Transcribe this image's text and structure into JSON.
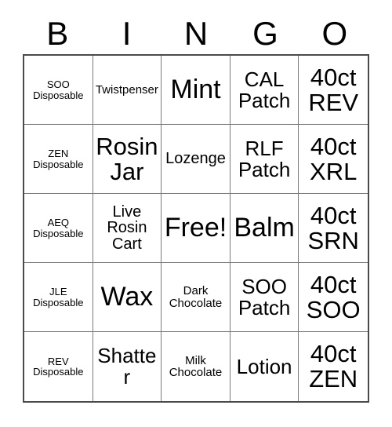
{
  "card": {
    "title": "BINGO",
    "header_letters": [
      "B",
      "I",
      "N",
      "G",
      "O"
    ],
    "columns": 5,
    "rows": 5,
    "free_space": {
      "row": 3,
      "column": 3,
      "label": "Free!"
    },
    "colors": {
      "background": "#ffffff",
      "text": "#000000",
      "grid_line": "#7a7a7a",
      "outer_border": "#4a4a4a"
    },
    "cells": [
      {
        "id": "c-r1-b",
        "row": 1,
        "column": 1,
        "column_letter": "B",
        "text": "SOO\nDisposable",
        "size": "xs"
      },
      {
        "id": "c-r1-i",
        "row": 1,
        "column": 2,
        "column_letter": "I",
        "text": "Twistpenser",
        "size": "sm"
      },
      {
        "id": "c-r1-n",
        "row": 1,
        "column": 3,
        "column_letter": "N",
        "text": "Mint",
        "size": "xxl"
      },
      {
        "id": "c-r1-g",
        "row": 1,
        "column": 4,
        "column_letter": "G",
        "text": "CAL\nPatch",
        "size": "lg"
      },
      {
        "id": "c-r1-o",
        "row": 1,
        "column": 5,
        "column_letter": "O",
        "text": "40ct\nREV",
        "size": "xl"
      },
      {
        "id": "c-r2-b",
        "row": 2,
        "column": 1,
        "column_letter": "B",
        "text": "ZEN\nDisposable",
        "size": "xs"
      },
      {
        "id": "c-r2-i",
        "row": 2,
        "column": 2,
        "column_letter": "I",
        "text": "Rosin\nJar",
        "size": "xl"
      },
      {
        "id": "c-r2-n",
        "row": 2,
        "column": 3,
        "column_letter": "N",
        "text": "Lozenge",
        "size": "md"
      },
      {
        "id": "c-r2-g",
        "row": 2,
        "column": 4,
        "column_letter": "G",
        "text": "RLF\nPatch",
        "size": "lg"
      },
      {
        "id": "c-r2-o",
        "row": 2,
        "column": 5,
        "column_letter": "O",
        "text": "40ct\nXRL",
        "size": "xl"
      },
      {
        "id": "c-r3-b",
        "row": 3,
        "column": 1,
        "column_letter": "B",
        "text": "AEQ\nDisposable",
        "size": "xs"
      },
      {
        "id": "c-r3-i",
        "row": 3,
        "column": 2,
        "column_letter": "I",
        "text": "Live\nRosin\nCart",
        "size": "md"
      },
      {
        "id": "c-r3-n",
        "row": 3,
        "column": 3,
        "column_letter": "N",
        "text": "Free!",
        "size": "xxl"
      },
      {
        "id": "c-r3-g",
        "row": 3,
        "column": 4,
        "column_letter": "G",
        "text": "Balm",
        "size": "xxl"
      },
      {
        "id": "c-r3-o",
        "row": 3,
        "column": 5,
        "column_letter": "O",
        "text": "40ct\nSRN",
        "size": "xl"
      },
      {
        "id": "c-r4-b",
        "row": 4,
        "column": 1,
        "column_letter": "B",
        "text": "JLE\nDisposable",
        "size": "xs"
      },
      {
        "id": "c-r4-i",
        "row": 4,
        "column": 2,
        "column_letter": "I",
        "text": "Wax",
        "size": "xxl"
      },
      {
        "id": "c-r4-n",
        "row": 4,
        "column": 3,
        "column_letter": "N",
        "text": "Dark\nChocolate",
        "size": "sm"
      },
      {
        "id": "c-r4-g",
        "row": 4,
        "column": 4,
        "column_letter": "G",
        "text": "SOO\nPatch",
        "size": "lg"
      },
      {
        "id": "c-r4-o",
        "row": 4,
        "column": 5,
        "column_letter": "O",
        "text": "40ct\nSOO",
        "size": "xl"
      },
      {
        "id": "c-r5-b",
        "row": 5,
        "column": 1,
        "column_letter": "B",
        "text": "REV\nDisposable",
        "size": "xs"
      },
      {
        "id": "c-r5-i",
        "row": 5,
        "column": 2,
        "column_letter": "I",
        "text": "Shatter",
        "size": "lg"
      },
      {
        "id": "c-r5-n",
        "row": 5,
        "column": 3,
        "column_letter": "N",
        "text": "Milk\nChocolate",
        "size": "sm"
      },
      {
        "id": "c-r5-g",
        "row": 5,
        "column": 4,
        "column_letter": "G",
        "text": "Lotion",
        "size": "lg"
      },
      {
        "id": "c-r5-o",
        "row": 5,
        "column": 5,
        "column_letter": "O",
        "text": "40ct\nZEN",
        "size": "xl"
      }
    ]
  }
}
